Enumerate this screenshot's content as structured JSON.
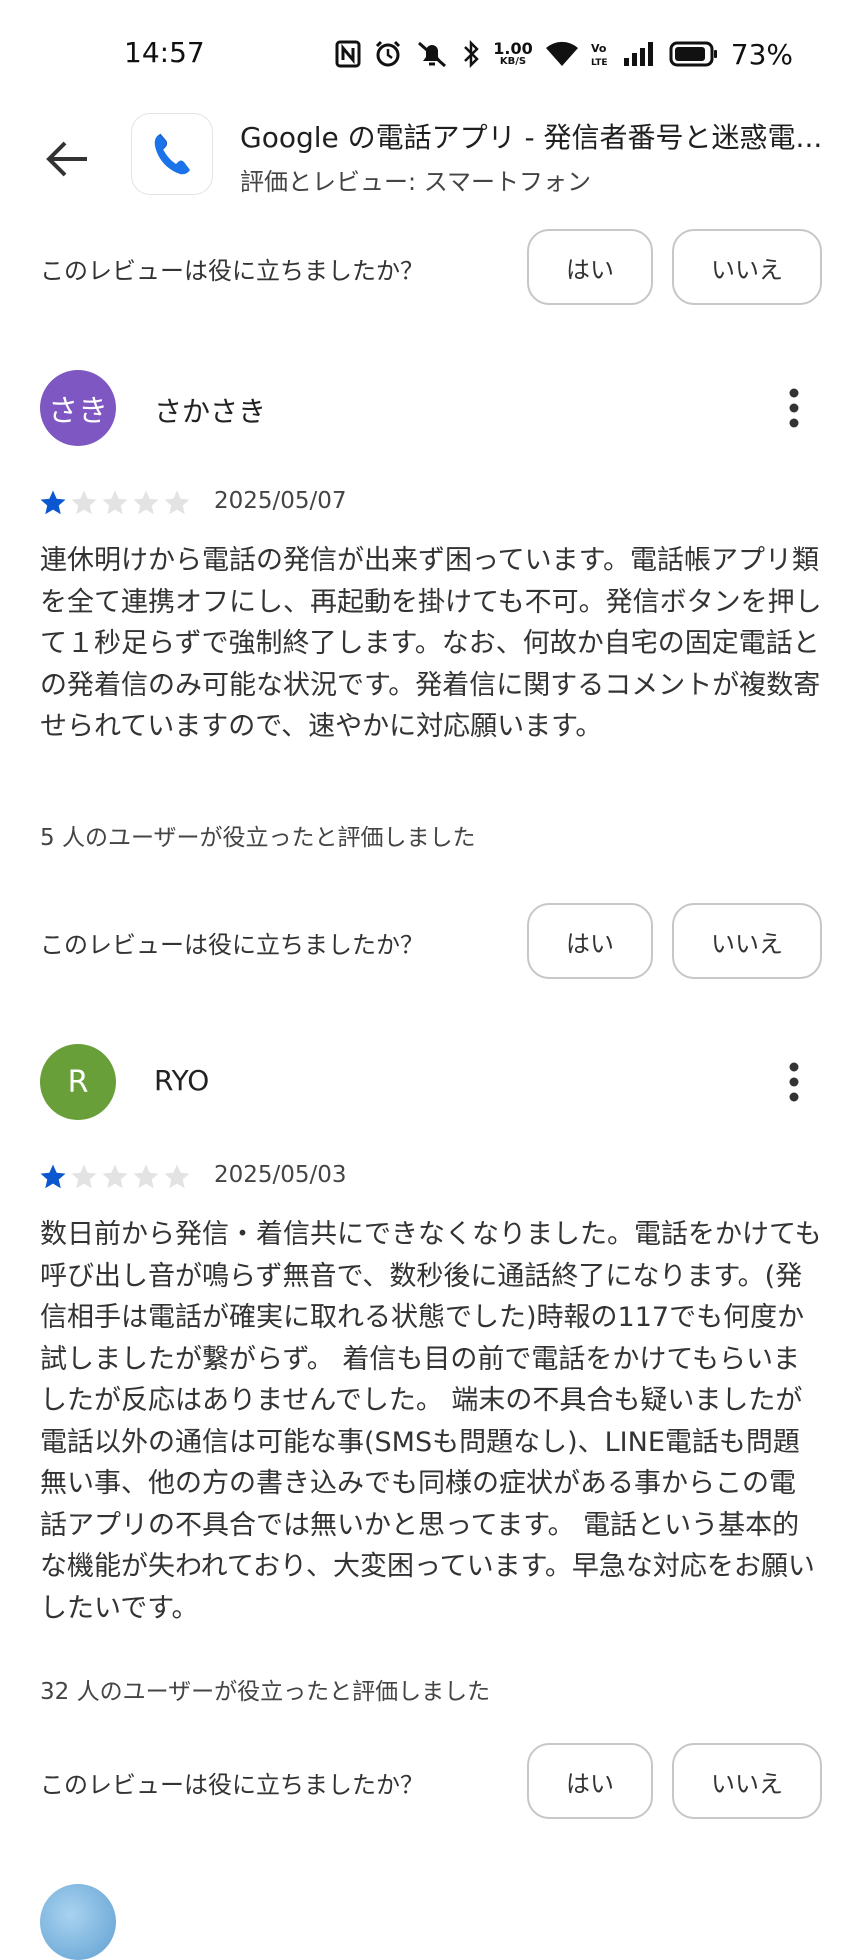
{
  "status_bar": {
    "time": "14:57",
    "net_speed_top": "1.00",
    "net_speed_bottom": "KB/S",
    "battery_percent": "73%"
  },
  "header": {
    "app_title": "Google の電話アプリ - 発信者番号と迷惑電...",
    "subtitle": "評価とレビュー: スマートフォン"
  },
  "helpful_prompt": {
    "question": "このレビューは役に立ちましたか？",
    "yes_label": "はい",
    "no_label": "いいえ"
  },
  "reviews": [
    {
      "avatar_text": "さき",
      "avatar_color": "#7e57c2",
      "name": "さかさき",
      "rating": 1,
      "date": "2025/05/07",
      "body": "連休明けから電話の発信が出来ず困っています。電話帳アプリ類を全て連携オフにし、再起動を掛けても不可。発信ボタンを押して１秒足らずで強制終了します。なお、何故か自宅の固定電話との発着信のみ可能な状況です。発着信に関するコメントが複数寄せられていますので、速やかに対応願います。",
      "helpful_count_text": "5 人のユーザーが役立ったと評価しました"
    },
    {
      "avatar_text": "R",
      "avatar_color": "#689f38",
      "name": "RYO",
      "rating": 1,
      "date": "2025/05/03",
      "body": "数日前から発信・着信共にできなくなりました。電話をかけても呼び出し音が鳴らず無音で、数秒後に通話終了になります。(発信相手は電話が確実に取れる状態でした)時報の117でも何度か試しましたが繋がらず。 着信も目の前で電話をかけてもらいましたが反応はありませんでした。 端末の不具合も疑いましたが電話以外の通信は可能な事(SMSも問題なし)、LINE電話も問題無い事、他の方の書き込みでも同様の症状がある事からこの電話アプリの不具合では無いかと思ってます。 電話という基本的な機能が失われており、大変困っています。早急な対応をお願いしたいです。",
      "helpful_count_text": "32 人のユーザーが役立ったと評価しました"
    }
  ]
}
